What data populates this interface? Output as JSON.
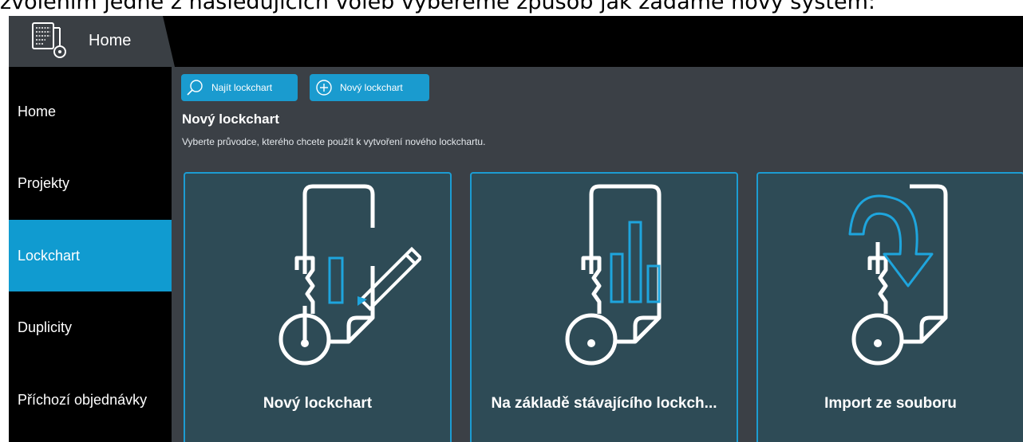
{
  "caption": "zvolením jedné z následujících voleb vybereme způsob jak zadáme nový systém:",
  "header": {
    "tab_title": "Home"
  },
  "sidebar": {
    "items": [
      {
        "label": "Home"
      },
      {
        "label": "Projekty"
      },
      {
        "label": "Lockchart",
        "active": true
      },
      {
        "label": "Duplicity"
      },
      {
        "label": "Příchozí objednávky"
      }
    ]
  },
  "toolbar": {
    "find_label": "Najít lockchart",
    "find_icon": "search-icon",
    "new_label": "Nový lockchart",
    "new_icon": "plus-circle-icon"
  },
  "main": {
    "title": "Nový lockchart",
    "subtitle": "Vyberte průvodce, kterého chcete použít k vytvoření nového lockchartu."
  },
  "cards": [
    {
      "label": "Nový lockchart",
      "icon": "document-pencil-icon"
    },
    {
      "label": "Na základě stávajícího lockch...",
      "icon": "document-chart-icon"
    },
    {
      "label": "Import ze souboru",
      "icon": "document-import-icon"
    }
  ],
  "colors": {
    "accent": "#109bd0",
    "content_bg": "#3b4046",
    "card_bg": "#2e4b56",
    "tab_bg": "#3a3f44"
  }
}
